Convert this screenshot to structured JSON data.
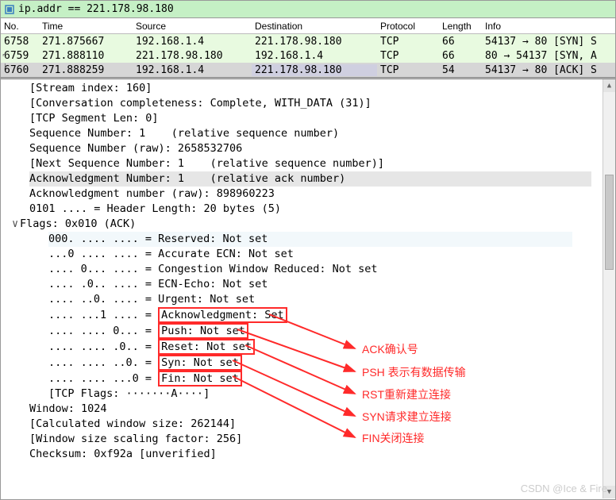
{
  "filter": {
    "text": "ip.addr == 221.178.98.180"
  },
  "columns": {
    "no": "No.",
    "time": "Time",
    "src": "Source",
    "dst": "Destination",
    "proto": "Protocol",
    "len": "Length",
    "info": "Info"
  },
  "packets": [
    {
      "no": "6758",
      "time": "271.875667",
      "src": "192.168.1.4",
      "dst": "221.178.98.180",
      "proto": "TCP",
      "len": "66",
      "info": "54137 → 80 [SYN] S"
    },
    {
      "no": "6759",
      "time": "271.888110",
      "src": "221.178.98.180",
      "dst": "192.168.1.4",
      "proto": "TCP",
      "len": "66",
      "info": "80 → 54137 [SYN, A"
    },
    {
      "no": "6760",
      "time": "271.888259",
      "src": "192.168.1.4",
      "dst": "221.178.98.180",
      "proto": "TCP",
      "len": "54",
      "info": "54137 → 80 [ACK] S"
    }
  ],
  "details": {
    "stream_index": "[Stream index: 160]",
    "conv": "[Conversation completeness: Complete, WITH_DATA (31)]",
    "seglen": "[TCP Segment Len: 0]",
    "seq": "Sequence Number: 1    (relative sequence number)",
    "seq_raw": "Sequence Number (raw): 2658532706",
    "next_seq": "[Next Sequence Number: 1    (relative sequence number)]",
    "ack_num": "Acknowledgment Number: 1    (relative ack number)",
    "ack_raw": "Acknowledgment number (raw): 898960223",
    "hdr": "0101 .... = Header Length: 20 bytes (5)",
    "flags": "Flags: 0x010 (ACK)",
    "reserved": "000. .... .... = Reserved: Not set",
    "aecn": "...0 .... .... = Accurate ECN: Not set",
    "cwr": ".... 0... .... = Congestion Window Reduced: Not set",
    "ece": ".... .0.. .... = ECN-Echo: Not set",
    "urg": ".... ..0. .... = Urgent: Not set",
    "ack": ".... ...1 .... = ",
    "ack_tag": "Acknowledgment: Set",
    "psh": ".... .... 0... = ",
    "psh_tag": "Push: Not set",
    "rst": ".... .... .0.. = ",
    "rst_tag": "Reset: Not set",
    "syn": ".... .... ..0. = ",
    "syn_tag": "Syn: Not set",
    "fin": ".... .... ...0 = ",
    "fin_tag": "Fin: Not set",
    "tcp_flags": "[TCP Flags: ·······A····]",
    "win": "Window: 1024",
    "calc_win": "[Calculated window size: 262144]",
    "scale": "[Window size scaling factor: 256]",
    "cksum": "Checksum: 0xf92a [unverified]"
  },
  "annotations": {
    "ack": "ACK确认号",
    "psh": "PSH 表示有数据传输",
    "rst": "RST重新建立连接",
    "syn": "SYN请求建立连接",
    "fin": "FIN关闭连接"
  },
  "watermark": "CSDN @Ice & Fire"
}
